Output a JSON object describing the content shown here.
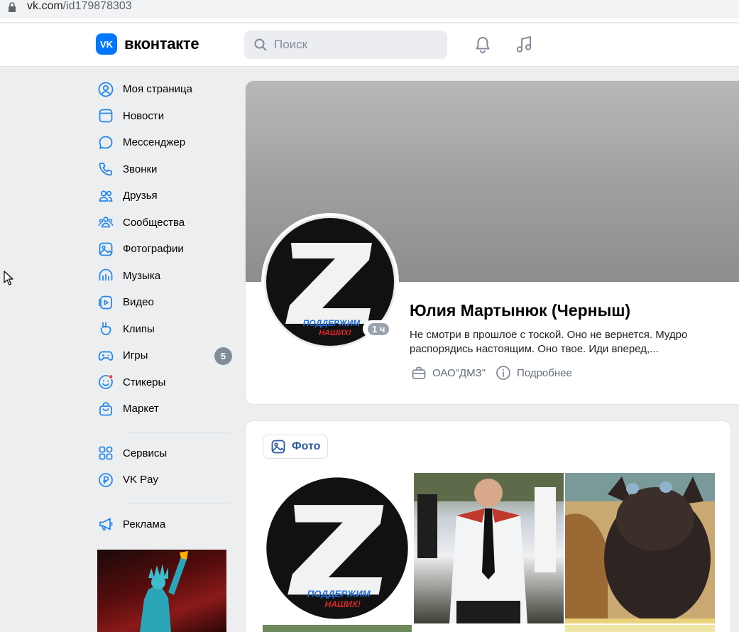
{
  "browser": {
    "url_host": "vk.com",
    "url_path": "/id179878303"
  },
  "header": {
    "logo_mark": "VK",
    "logo_text": "вконтакте",
    "search_placeholder": "Поиск"
  },
  "sidebar": {
    "items": [
      {
        "label": "Моя страница",
        "icon": "user-circle-icon"
      },
      {
        "label": "Новости",
        "icon": "newspaper-icon"
      },
      {
        "label": "Мессенджер",
        "icon": "message-bubble-icon"
      },
      {
        "label": "Звонки",
        "icon": "phone-icon"
      },
      {
        "label": "Друзья",
        "icon": "friends-icon"
      },
      {
        "label": "Сообщества",
        "icon": "communities-icon"
      },
      {
        "label": "Фотографии",
        "icon": "photo-icon"
      },
      {
        "label": "Музыка",
        "icon": "music-bars-icon"
      },
      {
        "label": "Видео",
        "icon": "video-icon"
      },
      {
        "label": "Клипы",
        "icon": "clips-icon"
      },
      {
        "label": "Игры",
        "icon": "gamepad-icon",
        "badge": "5"
      },
      {
        "label": "Стикеры",
        "icon": "sticker-icon"
      },
      {
        "label": "Маркет",
        "icon": "market-bag-icon"
      }
    ],
    "secondary": [
      {
        "label": "Сервисы",
        "icon": "services-grid-icon"
      },
      {
        "label": "VK Pay",
        "icon": "vkpay-icon"
      }
    ],
    "ads": {
      "label": "Реклама",
      "icon": "megaphone-icon"
    }
  },
  "profile": {
    "name": "Юлия Мартынюк (Черныш)",
    "online": "1 ч",
    "status_line1": "Не смотри в прошлое с тоской. Оно не вернется. Мудро",
    "status_line2": "распорядись настоящим. Оно твое. Иди вперед,...",
    "work": "ОАО\"ДМЗ\"",
    "more": "Подробнее",
    "avatar_letter": "Z",
    "avatar_caption_1": "ПОДДЕРЖИМ",
    "avatar_caption_2": "НАШИХ!"
  },
  "photos": {
    "tab_label": "Фото"
  },
  "colors": {
    "accent": "#0077ff",
    "link": "#2c5aa0",
    "muted": "#818c99",
    "background": "#edeef0"
  }
}
